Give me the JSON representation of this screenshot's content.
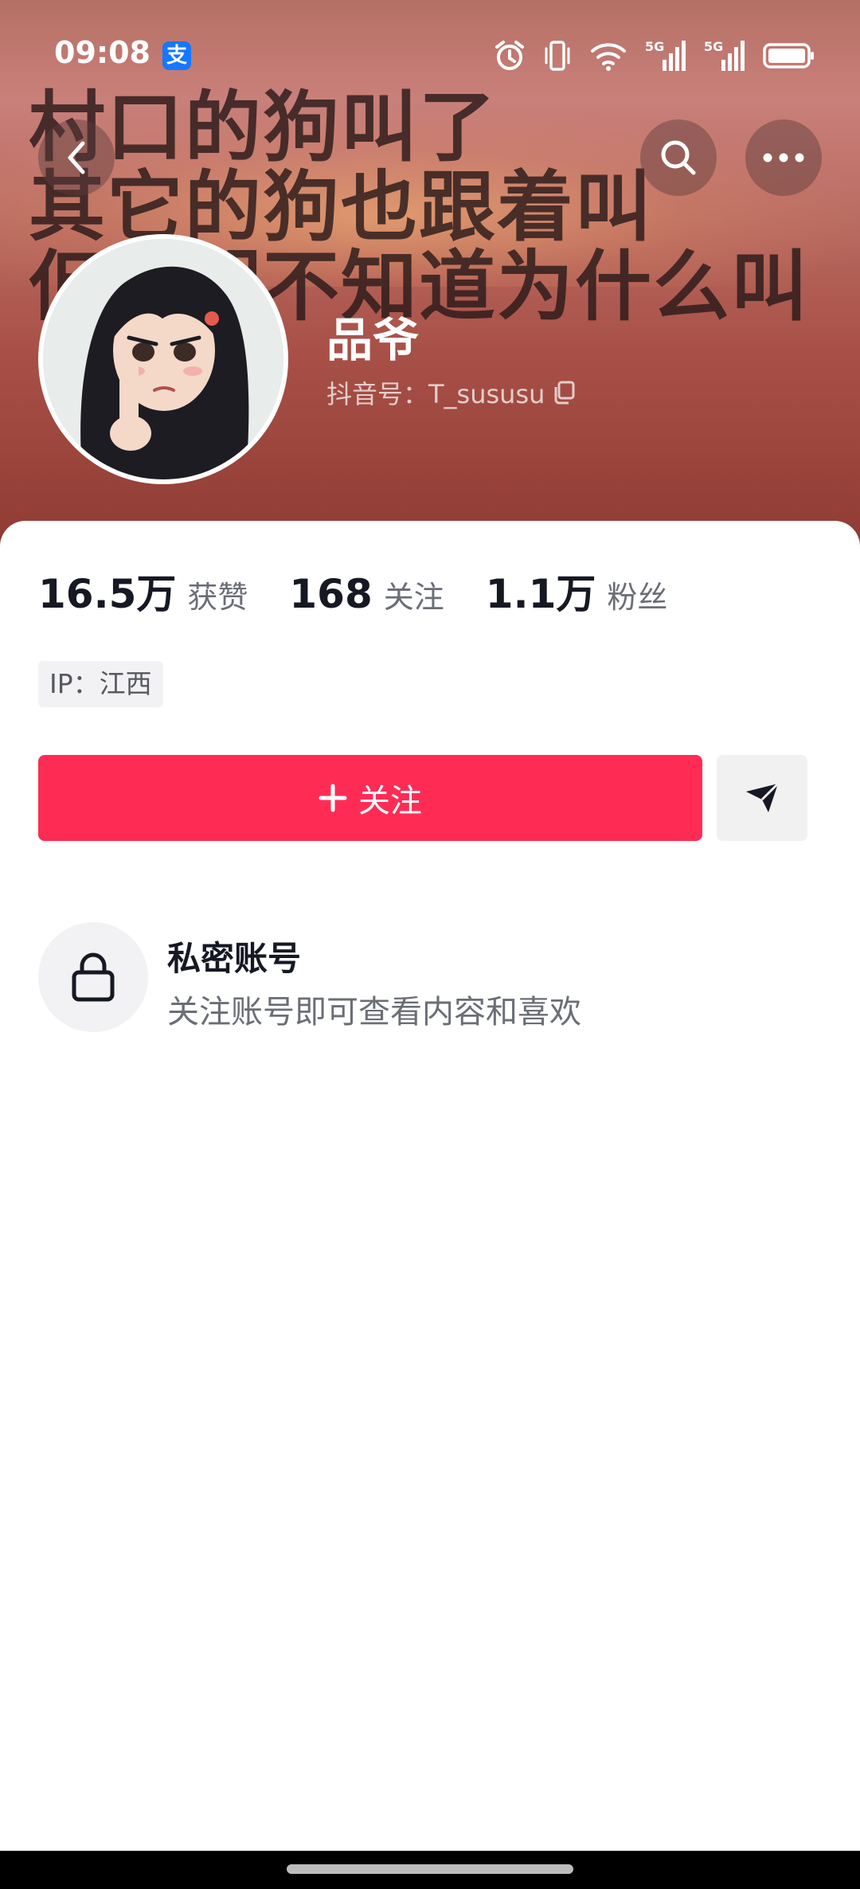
{
  "status_bar": {
    "time": "09:08",
    "alipay_glyph": "支",
    "network_label_1": "5G",
    "network_label_2": "5G",
    "icons": [
      "alarm-icon",
      "vibrate-icon",
      "wifi-icon",
      "signal-icon",
      "signal-icon",
      "battery-icon"
    ]
  },
  "banner": {
    "lines": [
      "村口的狗叫了",
      "其它的狗也跟着叫",
      "但它们不知道为什么叫"
    ]
  },
  "profile": {
    "nickname": "品爷",
    "douyin_id": "抖音号：T_sususu"
  },
  "stats": [
    {
      "value": "16.5万",
      "label": "获赞"
    },
    {
      "value": "168",
      "label": "关注"
    },
    {
      "value": "1.1万",
      "label": "粉丝"
    }
  ],
  "ip_location": "IP：江西",
  "actions": {
    "follow_label": "关注",
    "follow_icon": "plus-icon",
    "share_icon": "send-icon"
  },
  "private_notice": {
    "title": "私密账号",
    "description": "关注账号即可查看内容和喜欢",
    "icon": "lock-icon"
  },
  "colors": {
    "accent": "#fe2c55",
    "primary_text": "#161823",
    "secondary_text": "#6b6e76",
    "banner": "#b86a60"
  }
}
